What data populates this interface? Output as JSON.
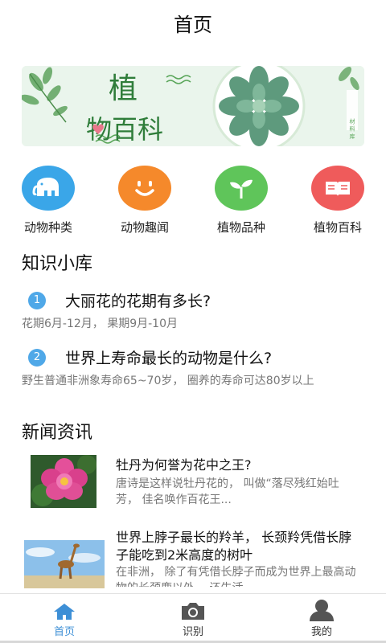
{
  "header": {
    "title": "首页"
  },
  "banner": {
    "title_char1": "植",
    "title_rest": "物百科",
    "side_text": "材 料 库"
  },
  "quick_links": [
    {
      "label": "动物种类",
      "icon": "elephant-icon",
      "color": "#3aa6e8"
    },
    {
      "label": "动物趣闻",
      "icon": "smiley-icon",
      "color": "#f5892b"
    },
    {
      "label": "植物品种",
      "icon": "sprout-icon",
      "color": "#5fc55a"
    },
    {
      "label": "植物百科",
      "icon": "book-icon",
      "color": "#ef5b5b"
    }
  ],
  "knowledge": {
    "title": "知识小库",
    "items": [
      {
        "num": "1",
        "question": "大丽花的花期有多长?",
        "answer": "花期6月-12月， 果期9月-10月"
      },
      {
        "num": "2",
        "question": "世界上寿命最长的动物是什么?",
        "answer": "野生普通非洲象寿命65~70岁， 圈养的寿命可达80岁以上"
      }
    ]
  },
  "news": {
    "title": "新闻资讯",
    "items": [
      {
        "title": "牡丹为何誉为花中之王?",
        "summary": "唐诗是这样说牡丹花的， 叫做“落尽残红始吐芳， 佳名唤作百花王..."
      },
      {
        "title": "世界上脖子最长的羚羊， 长颈羚凭借长脖子能吃到2米高度的树叶",
        "summary": "在非洲， 除了有凭借长脖子而成为世界上最高动物的长颈鹿以外， 还生活"
      }
    ]
  },
  "tabbar": {
    "tabs": [
      {
        "label": "首页",
        "icon": "home-icon",
        "active": true
      },
      {
        "label": "识别",
        "icon": "camera-icon",
        "active": false
      },
      {
        "label": "我的",
        "icon": "user-icon",
        "active": false
      }
    ]
  },
  "colors": {
    "accent": "#3d8fd6",
    "badge": "#4fa8e8"
  }
}
